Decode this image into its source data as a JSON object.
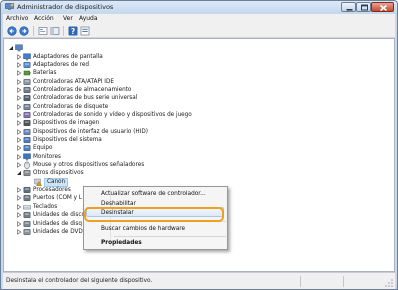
{
  "window": {
    "title": "Administrador de dispositivos",
    "buttons": [
      "minimize",
      "maximize",
      "close"
    ]
  },
  "menubar": {
    "items": [
      "Archivo",
      "Acción",
      "Ver",
      "Ayuda"
    ]
  },
  "toolbar": {
    "icons": [
      "back-arrow-icon",
      "forward-arrow-icon",
      "device-tree-view-icon",
      "console-view-icon",
      "help-icon",
      "properties-icon"
    ]
  },
  "tree": {
    "computer_name": "",
    "items": [
      {
        "label": "Adaptadores de pantalla",
        "icon": "display-adapter-icon",
        "expanded": false
      },
      {
        "label": "Adaptadores de red",
        "icon": "network-adapter-icon",
        "expanded": false
      },
      {
        "label": "Baterías",
        "icon": "battery-icon",
        "expanded": false
      },
      {
        "label": "Controladoras ATA/ATAPI IDE",
        "icon": "ide-controller-icon",
        "expanded": false
      },
      {
        "label": "Controladoras de almacenamiento",
        "icon": "storage-controller-icon",
        "expanded": false
      },
      {
        "label": "Controladoras de bus serie universal",
        "icon": "usb-icon",
        "expanded": false
      },
      {
        "label": "Controladoras de disquete",
        "icon": "floppy-controller-icon",
        "expanded": false
      },
      {
        "label": "Controladoras de sonido y vídeo y dispositivos de juego",
        "icon": "sound-icon",
        "expanded": false
      },
      {
        "label": "Dispositivos de imagen",
        "icon": "camera-icon",
        "expanded": false
      },
      {
        "label": "Dispositivos de interfaz de usuario (HID)",
        "icon": "hid-icon",
        "expanded": false
      },
      {
        "label": "Dispositivos del sistema",
        "icon": "system-device-icon",
        "expanded": false
      },
      {
        "label": "Equipo",
        "icon": "computer-icon",
        "expanded": false
      },
      {
        "label": "Monitores",
        "icon": "monitor-icon",
        "expanded": false
      },
      {
        "label": "Mouse y otros dispositivos señaladores",
        "icon": "mouse-icon",
        "expanded": false
      },
      {
        "label": "Otros dispositivos",
        "icon": "unknown-device-icon",
        "expanded": true
      },
      {
        "label": "Canon",
        "icon": "warning-device-icon",
        "child": true,
        "selected": true
      },
      {
        "label": "Procesadores",
        "icon": "processor-icon",
        "expanded": false
      },
      {
        "label": "Puertos (COM y L",
        "icon": "port-icon",
        "expanded": false
      },
      {
        "label": "Teclados",
        "icon": "keyboard-icon",
        "expanded": false
      },
      {
        "label": "Unidades de disco",
        "icon": "disk-drive-icon",
        "expanded": false
      },
      {
        "label": "Unidades de disq",
        "icon": "floppy-drive-icon",
        "expanded": false
      },
      {
        "label": "Unidades de DVD",
        "icon": "dvd-drive-icon",
        "expanded": false
      }
    ]
  },
  "context_menu": {
    "items": [
      {
        "label": "Actualizar software de controlador...",
        "bold": false
      },
      {
        "label": "Deshabilitar",
        "bold": false
      },
      {
        "label": "Desinstalar",
        "bold": false,
        "highlighted": true
      },
      {
        "label": "Buscar cambios de hardware",
        "bold": false
      },
      {
        "label": "Propiedades",
        "bold": true
      }
    ]
  },
  "status": {
    "text": "Desinstala el controlador del siguiente dispositivo."
  },
  "colors": {
    "highlight_ring": "#f0a020",
    "selection": "#cce4f7",
    "titlebar": "#c4d7ee"
  }
}
